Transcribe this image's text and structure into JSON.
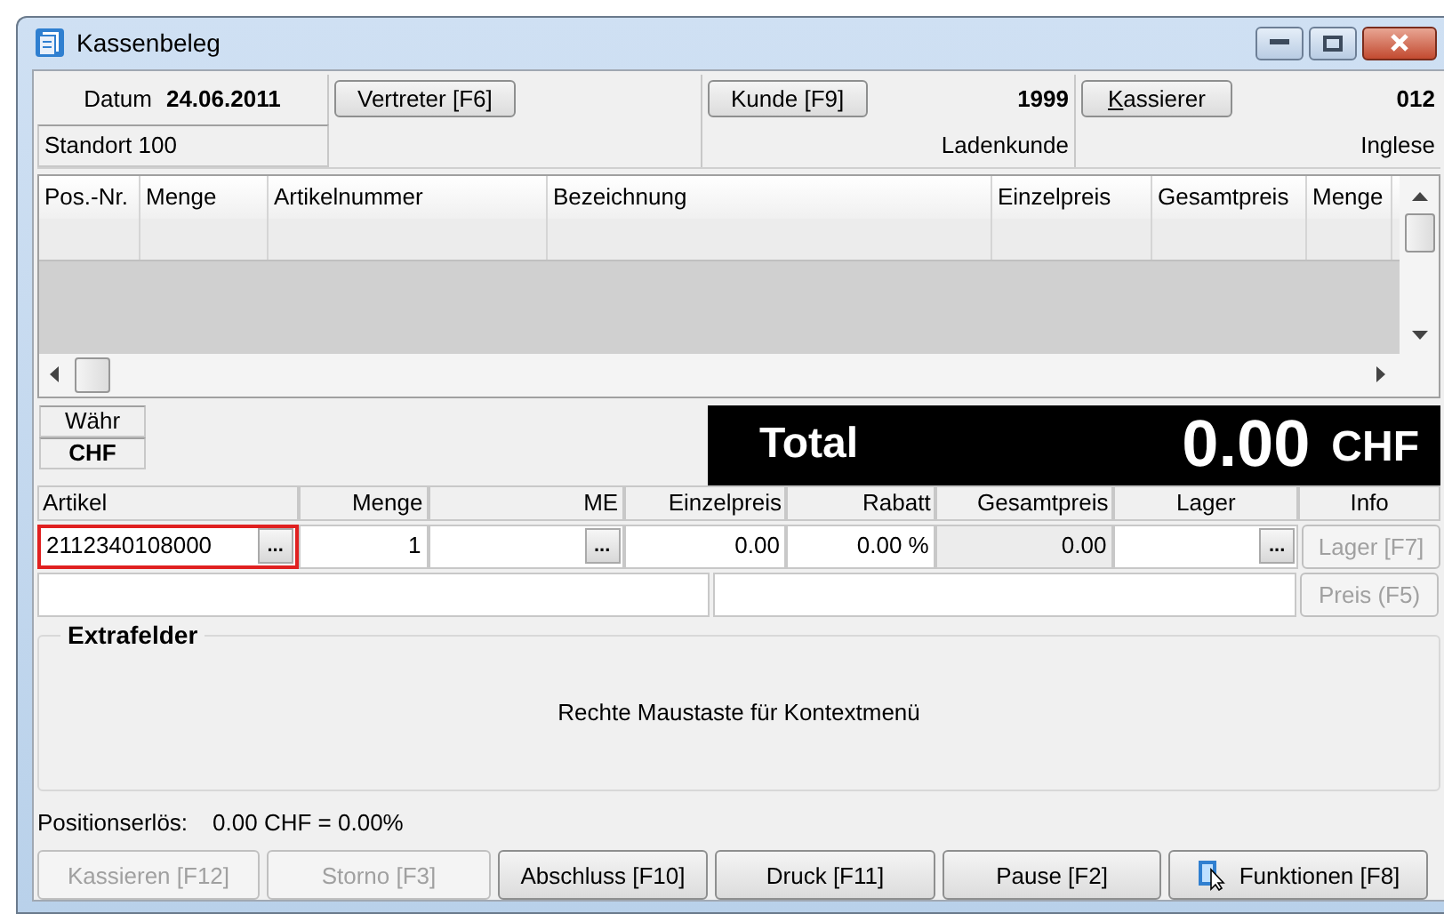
{
  "window": {
    "title": "Kassenbeleg"
  },
  "header": {
    "date_label": "Datum",
    "date_value": "24.06.2011",
    "location": "Standort 100",
    "vertreter_button": {
      "label": "Vertreter [F6]"
    },
    "kunde_button": {
      "label": "Kunde [F9]"
    },
    "kunde_number": "1999",
    "kunde_name": "Ladenkunde",
    "kassierer_button": {
      "label": "Kassierer",
      "access_key_underlined": true
    },
    "kassierer_number": "012",
    "kassierer_name": "Inglese"
  },
  "positions_table": {
    "columns": [
      "Pos.-Nr.",
      "Menge",
      "Artikelnummer",
      "Bezeichnung",
      "Einzelpreis",
      "Gesamtpreis",
      "Menge"
    ]
  },
  "currency": {
    "label": "Währ",
    "value": "CHF"
  },
  "total": {
    "label": "Total",
    "amount": "0.00",
    "currency": "CHF"
  },
  "entry": {
    "columns": [
      "Artikel",
      "Menge",
      "ME",
      "Einzelpreis",
      "Rabatt",
      "Gesamtpreis",
      "Lager",
      "Info"
    ],
    "artikel": {
      "value": "2112340108000",
      "highlighted": true
    },
    "menge": "1",
    "einzelpreis": "0.00",
    "rabatt": "0.00 %",
    "gesamtpreis": "0.00",
    "browse_buttons": [
      "...",
      "...",
      "..."
    ],
    "info_buttons": [
      {
        "label": "Lager [F7]",
        "disabled": true
      },
      {
        "label": "Preis (F5)",
        "disabled": true
      }
    ]
  },
  "extrafelder": {
    "title": "Extrafelder",
    "hint": "Rechte Maustaste für Kontextmenü"
  },
  "position_revenue": {
    "label": "Positionserlös:",
    "value": "0.00 CHF = 0.00%"
  },
  "buttons": [
    {
      "label": "Kassieren [F12]",
      "disabled": true,
      "kind": "plain"
    },
    {
      "label": "Storno [F3]",
      "disabled": true,
      "kind": "plain"
    },
    {
      "label": "Abschluss [F10]",
      "disabled": false,
      "kind": "plain"
    },
    {
      "label": "Druck [F11]",
      "disabled": false,
      "kind": "plain"
    },
    {
      "label": "Pause [F2]",
      "disabled": false,
      "kind": "plain"
    },
    {
      "label": "Funktionen [F8]",
      "disabled": false,
      "kind": "menu"
    }
  ]
}
